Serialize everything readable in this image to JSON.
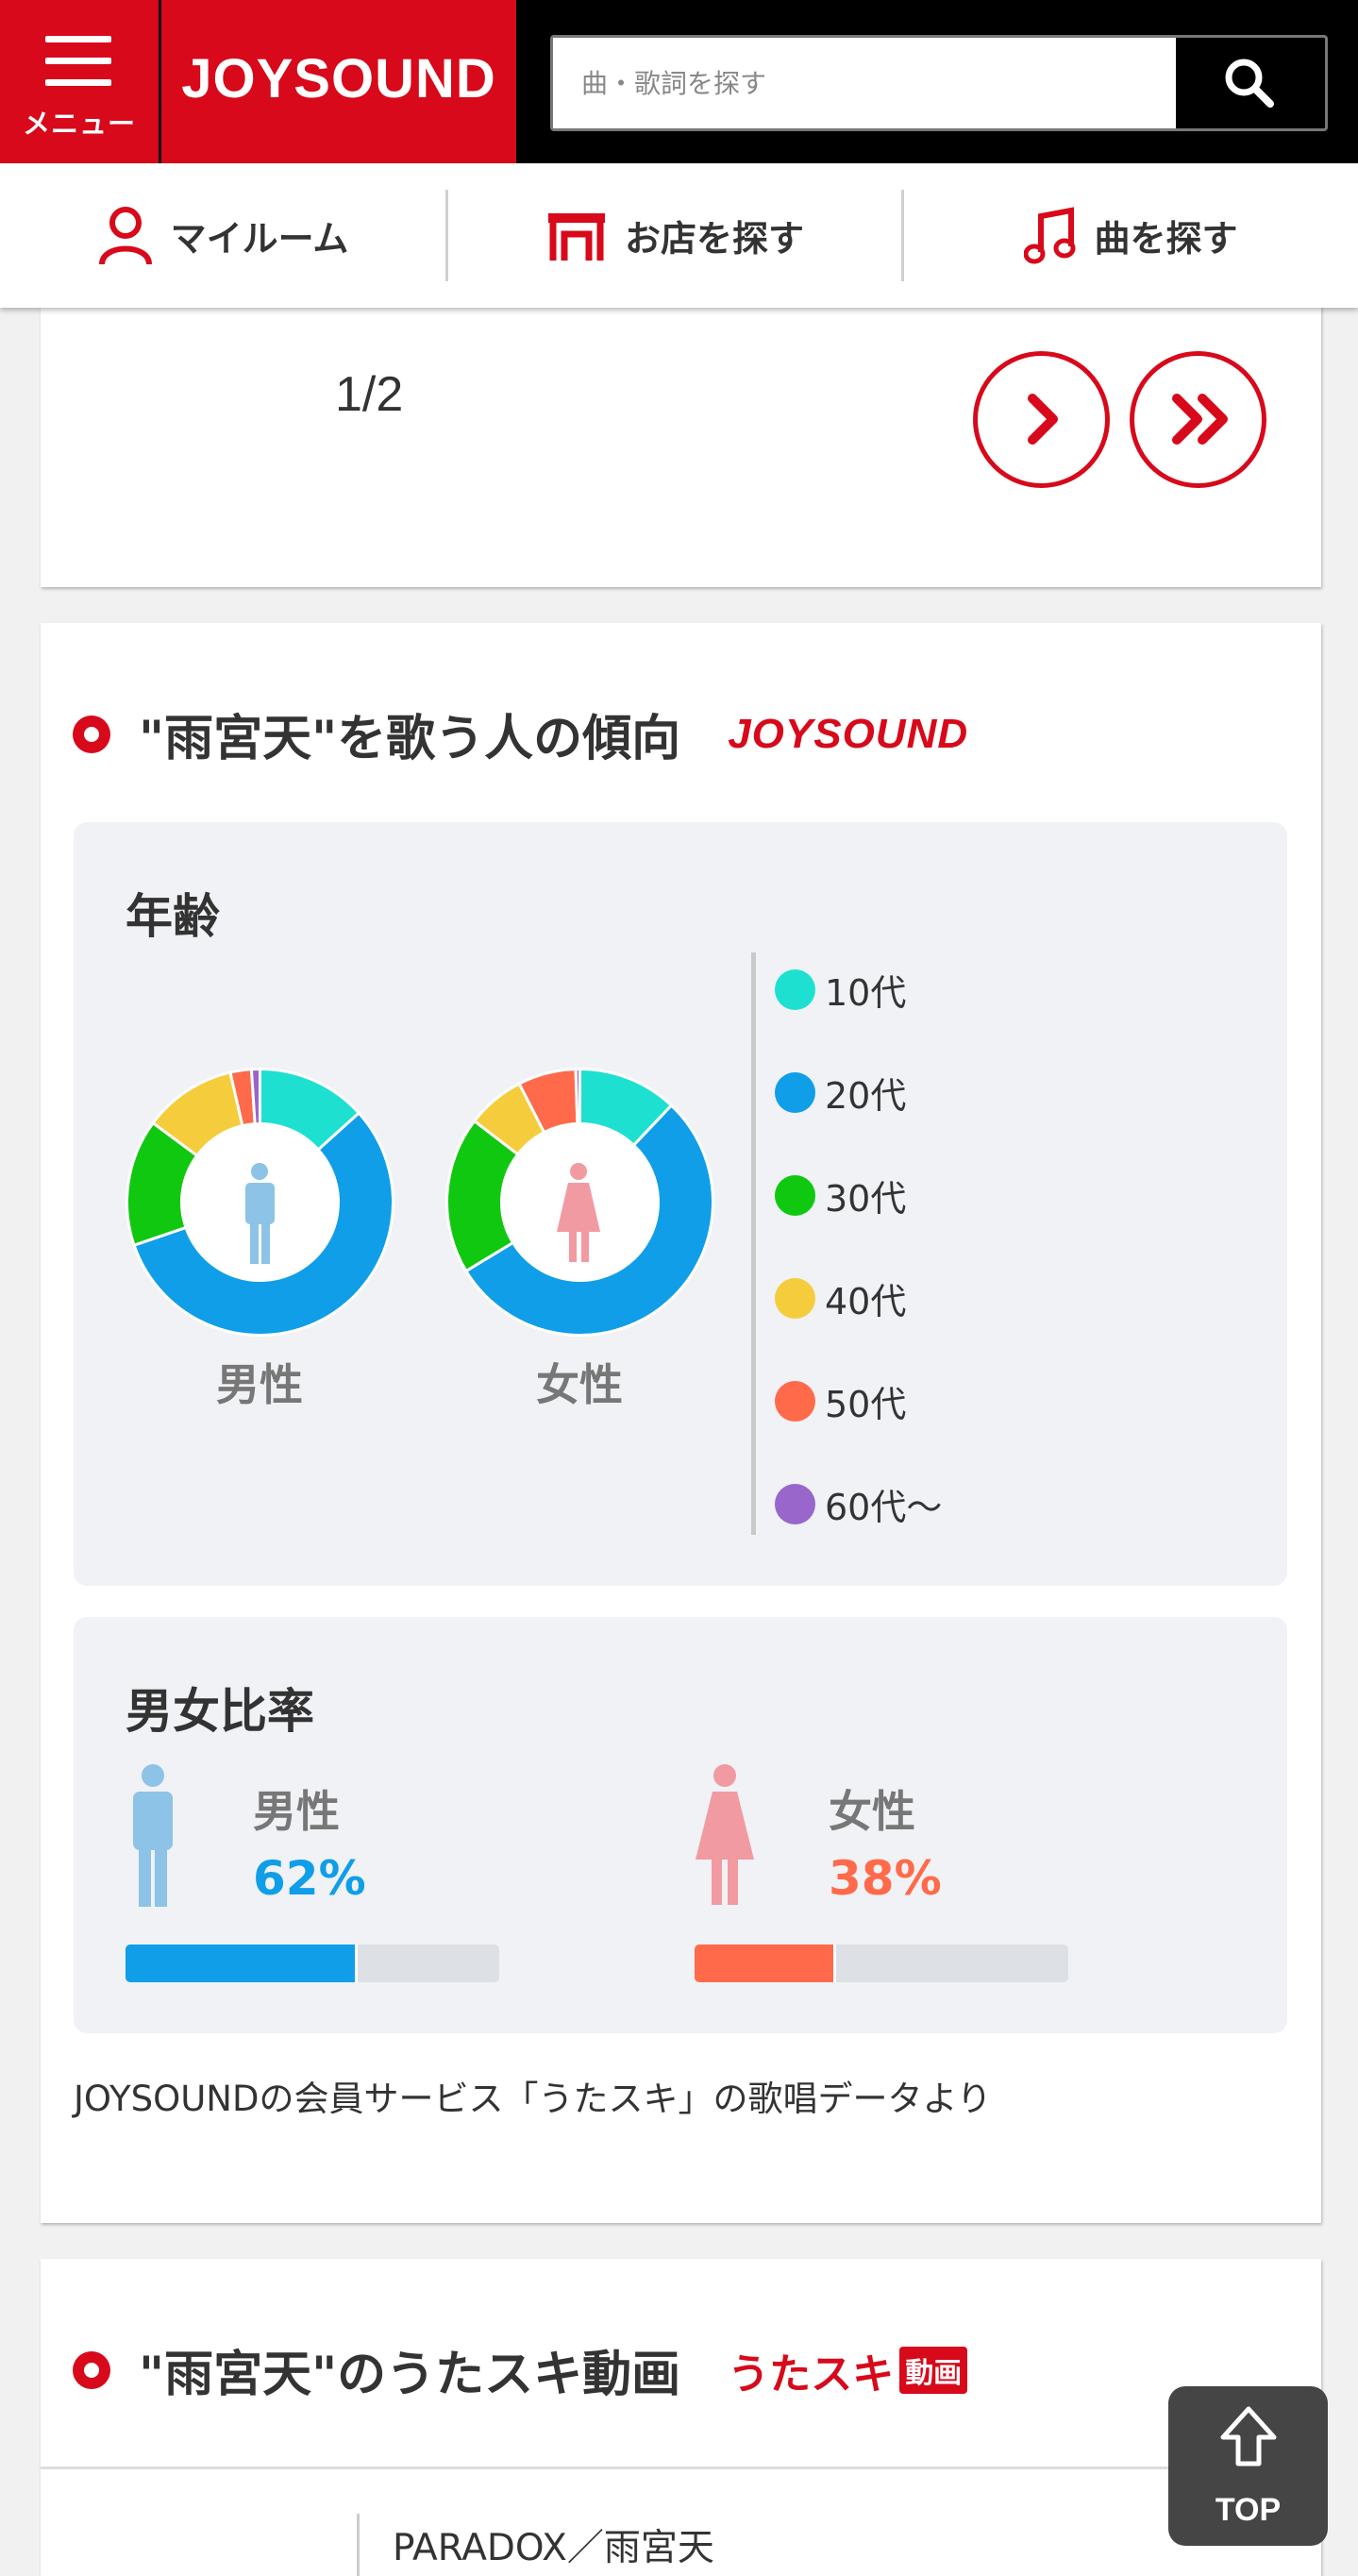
{
  "header": {
    "menu_label": "メニュー",
    "logo": "JOYSOUND",
    "search_placeholder": "曲・歌詞を探す"
  },
  "subnav": {
    "items": [
      {
        "label": "マイルーム",
        "icon": "person-icon"
      },
      {
        "label": "お店を探す",
        "icon": "shop-icon"
      },
      {
        "label": "曲を探す",
        "icon": "music-note-icon"
      }
    ]
  },
  "pager": {
    "text": "1/2",
    "next_icon": "chevron-right-icon",
    "last_icon": "double-chevron-right-icon"
  },
  "trend": {
    "title": "\"雨宮天\"を歌う人の傾向",
    "logo": "JOYSOUND",
    "age": {
      "title": "年齢",
      "male_label": "男性",
      "female_label": "女性",
      "legend": [
        {
          "label": "10代",
          "color": "#1ee0d0"
        },
        {
          "label": "20代",
          "color": "#109ee8"
        },
        {
          "label": "30代",
          "color": "#11c811"
        },
        {
          "label": "40代",
          "color": "#f5cd3c"
        },
        {
          "label": "50代",
          "color": "#ff6a4a"
        },
        {
          "label": "60代〜",
          "color": "#9966cc"
        }
      ]
    },
    "ratio": {
      "title": "男女比率",
      "male_label": "男性",
      "male_pct": "62%",
      "male_value": 62,
      "male_color": "#109ee8",
      "female_label": "女性",
      "female_pct": "38%",
      "female_value": 38,
      "female_color": "#ff6a4a"
    },
    "source_note": "JOYSOUNDの会員サービス「うたスキ」の歌唱データより"
  },
  "chart_data": [
    {
      "type": "pie",
      "label": "男性",
      "categories": [
        "10代",
        "20代",
        "30代",
        "40代",
        "50代",
        "60代〜"
      ],
      "values": [
        13,
        55,
        15,
        11,
        2.5,
        1
      ]
    },
    {
      "type": "pie",
      "label": "女性",
      "categories": [
        "10代",
        "20代",
        "30代",
        "40代",
        "50代",
        "60代〜"
      ],
      "values": [
        12,
        54,
        19,
        7,
        7,
        0.5
      ]
    }
  ],
  "video": {
    "title": "\"雨宮天\"のうたスキ動画",
    "logo_text": "うたスキ",
    "logo_badge": "動画",
    "first_item": "PARADOX／雨宮天"
  },
  "top_button": {
    "label": "TOP"
  }
}
